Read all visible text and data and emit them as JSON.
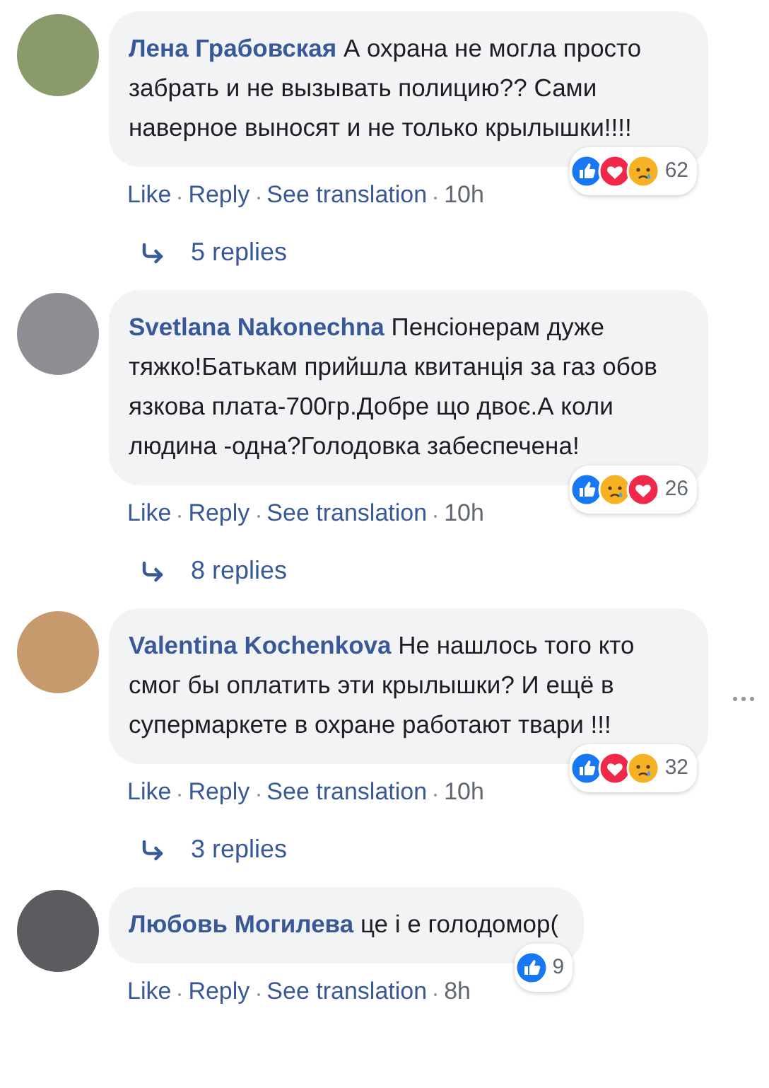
{
  "comments": [
    {
      "author": "Лена Грабовская",
      "text": "А охрана не могла просто забрать и не вызывать полицию?? Сами наверное выносят и не только крылышки!!!!",
      "reactions": [
        {
          "kind": "like"
        },
        {
          "kind": "love"
        },
        {
          "kind": "sad"
        }
      ],
      "reaction_count": "62",
      "actions": [
        "Like",
        "Reply",
        "See translation"
      ],
      "time": "10h",
      "replies": "5 replies",
      "more_options": false
    },
    {
      "author": "Svetlana Nakonechna",
      "text": "Пенсіонерам дуже тяжко!Батькам прийшла квитанція за газ обов язкова плата-700гр.Добре що двоє.А коли людина -одна?Голодовка забеспечена!",
      "reactions": [
        {
          "kind": "like"
        },
        {
          "kind": "sad"
        },
        {
          "kind": "love"
        }
      ],
      "reaction_count": "26",
      "actions": [
        "Like",
        "Reply",
        "See translation"
      ],
      "time": "10h",
      "replies": "8 replies",
      "more_options": false
    },
    {
      "author": "Valentina Kochenkova",
      "text": "Не нашлось того кто смог бы оплатить эти крылышки? И ещё в супермаркете в охране работают твари !!!",
      "reactions": [
        {
          "kind": "like"
        },
        {
          "kind": "love"
        },
        {
          "kind": "sad"
        }
      ],
      "reaction_count": "32",
      "actions": [
        "Like",
        "Reply",
        "See translation"
      ],
      "time": "10h",
      "replies": "3 replies",
      "more_options": true
    },
    {
      "author": "Любовь Могилева",
      "text": "це і е голодомор(",
      "reactions": [
        {
          "kind": "like"
        }
      ],
      "reaction_count": "9",
      "actions": [
        "Like",
        "Reply",
        "See translation"
      ],
      "time": "8h",
      "more_options": false
    }
  ]
}
